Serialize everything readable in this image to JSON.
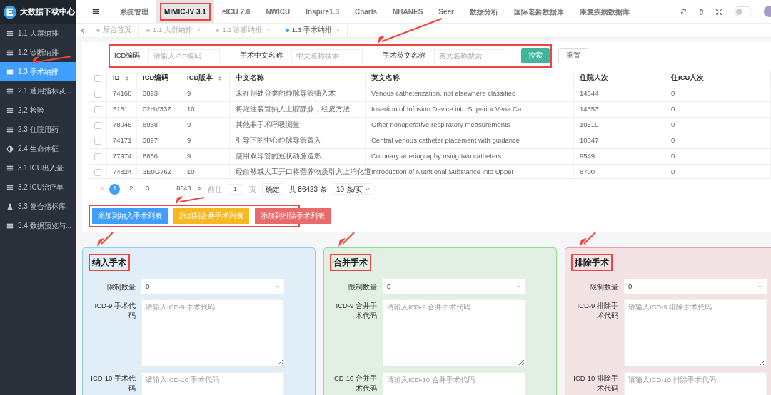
{
  "app": {
    "title": "大数据下载中心"
  },
  "sidebar": {
    "items": [
      {
        "label": "1.1 人群纳排",
        "kind": "list",
        "selected": false,
        "highlighted": false
      },
      {
        "label": "1.2 诊断纳排",
        "kind": "list",
        "selected": false,
        "highlighted": false
      },
      {
        "label": "1.3 手术纳排",
        "kind": "list",
        "selected": true,
        "highlighted": true
      },
      {
        "label": "2.1 通用指标及...",
        "kind": "list",
        "selected": false,
        "highlighted": false
      },
      {
        "label": "2.2 检验",
        "kind": "list",
        "selected": false,
        "highlighted": false
      },
      {
        "label": "2.3 住院用药",
        "kind": "list",
        "selected": false,
        "highlighted": false
      },
      {
        "label": "2.4 生命体征",
        "kind": "contrast",
        "selected": false,
        "highlighted": false
      },
      {
        "label": "3.1 ICU出入量",
        "kind": "list",
        "selected": false,
        "highlighted": false
      },
      {
        "label": "3.2 ICU治疗单",
        "kind": "list",
        "selected": false,
        "highlighted": false
      },
      {
        "label": "3.3 复合指标库",
        "kind": "flask",
        "selected": false,
        "highlighted": false
      },
      {
        "label": "3.4 数据预览与...",
        "kind": "list",
        "selected": false,
        "highlighted": false
      }
    ]
  },
  "top_nav": {
    "items": [
      {
        "label": "系统管理",
        "selected": false,
        "highlighted": false
      },
      {
        "label": "MIMIC-IV 3.1",
        "selected": true,
        "highlighted": true
      },
      {
        "label": "eICU 2.0",
        "selected": false,
        "highlighted": false
      },
      {
        "label": "NWICU",
        "selected": false,
        "highlighted": false
      },
      {
        "label": "Inspire1.3",
        "selected": false,
        "highlighted": false
      },
      {
        "label": "Charls",
        "selected": false,
        "highlighted": false
      },
      {
        "label": "NHANES",
        "selected": false,
        "highlighted": false
      },
      {
        "label": "Seer",
        "selected": false,
        "highlighted": false
      },
      {
        "label": "数据分析",
        "selected": false,
        "highlighted": false
      },
      {
        "label": "国际老龄数据库",
        "selected": false,
        "highlighted": false
      },
      {
        "label": "康复疾病数据库",
        "selected": false,
        "highlighted": false
      }
    ],
    "theme_switch": {
      "on": false
    }
  },
  "page_tabs": [
    {
      "label": "后台首页",
      "selected": false
    },
    {
      "label": "1.1 人群纳排",
      "close": "×",
      "selected": false
    },
    {
      "label": "1.2 诊断纳排",
      "close": "×",
      "selected": false
    },
    {
      "label": "1.3 手术纳排",
      "close": "×",
      "selected": true
    }
  ],
  "search": {
    "highlighted": true,
    "fields": [
      {
        "label": "ICD编码",
        "placeholder": "请输入ICD编码"
      },
      {
        "label": "手术中文名称",
        "placeholder": "中文名称搜索"
      },
      {
        "label": "手术英文名称",
        "placeholder": "英文名称搜索"
      }
    ],
    "buttons": [
      {
        "label": "搜索",
        "kind": "primary"
      },
      {
        "label": "重置",
        "kind": "default"
      }
    ]
  },
  "table": {
    "select_all": {
      "checked": false
    },
    "columns": [
      {
        "label": "ID",
        "sortable": true
      },
      {
        "label": "ICD编码",
        "sortable": false
      },
      {
        "label": "ICD版本",
        "sortable": true
      },
      {
        "label": "中文名称",
        "sortable": false
      },
      {
        "label": "英文名称",
        "sortable": false
      },
      {
        "label": "住院人次",
        "sortable": false
      },
      {
        "label": "住ICU人次",
        "sortable": false
      }
    ],
    "rows": [
      {
        "checked": false,
        "cells": [
          "74168",
          "3893",
          "9",
          "未在别处分类的静脉导管插入术",
          "Venous catheterization, not elsewhere classified",
          "14644",
          "0"
        ]
      },
      {
        "checked": false,
        "cells": [
          "5181",
          "02HV33Z",
          "10",
          "将灌注装置插入上腔静脉，经皮方法",
          "Insertion of Infusion Device into Superior Vena Ca...",
          "14353",
          "0"
        ]
      },
      {
        "checked": false,
        "cells": [
          "78045",
          "8938",
          "9",
          "其他非手术呼吸测量",
          "Other nonoperative respiratory measurements",
          "10519",
          "0"
        ]
      },
      {
        "checked": false,
        "cells": [
          "74171",
          "3897",
          "9",
          "引导下的中心静脉导管置入",
          "Central venous catheter placement with guidance",
          "10347",
          "0"
        ]
      },
      {
        "checked": false,
        "cells": [
          "77974",
          "8856",
          "9",
          "使用双导管的冠状动脉造影",
          "Coronary arteriography using two catheters",
          "9549",
          "0"
        ]
      },
      {
        "checked": false,
        "cells": [
          "74824",
          "3E0G76Z",
          "10",
          "经自然或人工开口将营养物质引入上消化道",
          "Introduction of Nutritional Substance into Upper",
          "8700",
          "0"
        ]
      }
    ]
  },
  "pagination": {
    "prev": "<",
    "pages": [
      {
        "label": "1",
        "selected": true
      },
      {
        "label": "2",
        "selected": false
      },
      {
        "label": "3",
        "selected": false
      },
      {
        "label": "...",
        "selected": false
      },
      {
        "label": "8643",
        "selected": false
      }
    ],
    "next": ">",
    "goto_label": "前往",
    "goto_value": "1",
    "page_unit": "页",
    "confirm": "确定",
    "total": "共 86423 条",
    "page_size": "10 条/页"
  },
  "actions": {
    "highlighted": true,
    "buttons": [
      {
        "label": "添加到纳入手术列表",
        "color": "#409eff"
      },
      {
        "label": "添加到合并手术列表",
        "color": "#f5b820"
      },
      {
        "label": "添加到排除手术列表",
        "color": "#e86a6a"
      }
    ]
  },
  "panels": [
    {
      "title": "纳入手术",
      "color": "#8fcdf5",
      "highlighted": true,
      "limit_label": "限制数量",
      "limit_value": "0",
      "fields": [
        {
          "label": "ICD-9 手术代码",
          "placeholder": "请输入ICD-9 手术代码"
        },
        {
          "label": "ICD-10 手术代码",
          "placeholder": "请输入ICD-10 手术代码"
        }
      ]
    },
    {
      "title": "合并手术",
      "color": "#8fdc8a",
      "highlighted": true,
      "limit_label": "限制数量",
      "limit_value": "0",
      "fields": [
        {
          "label": "ICD-9 合并手术代码",
          "placeholder": "请输入ICD-9 合并手术代码"
        },
        {
          "label": "ICD-10 合并手术代码",
          "placeholder": "请输入ICD-10 合并手术代码"
        }
      ]
    },
    {
      "title": "排除手术",
      "color": "#f09a9a",
      "highlighted": true,
      "limit_label": "限制数量",
      "limit_value": "0",
      "fields": [
        {
          "label": "ICD-9 排除手术代码",
          "placeholder": "请输入ICD-9 排除手术代码"
        },
        {
          "label": "ICD-10 排除手术代码",
          "placeholder": "请输入ICD-10 排除手术代码"
        }
      ]
    }
  ]
}
